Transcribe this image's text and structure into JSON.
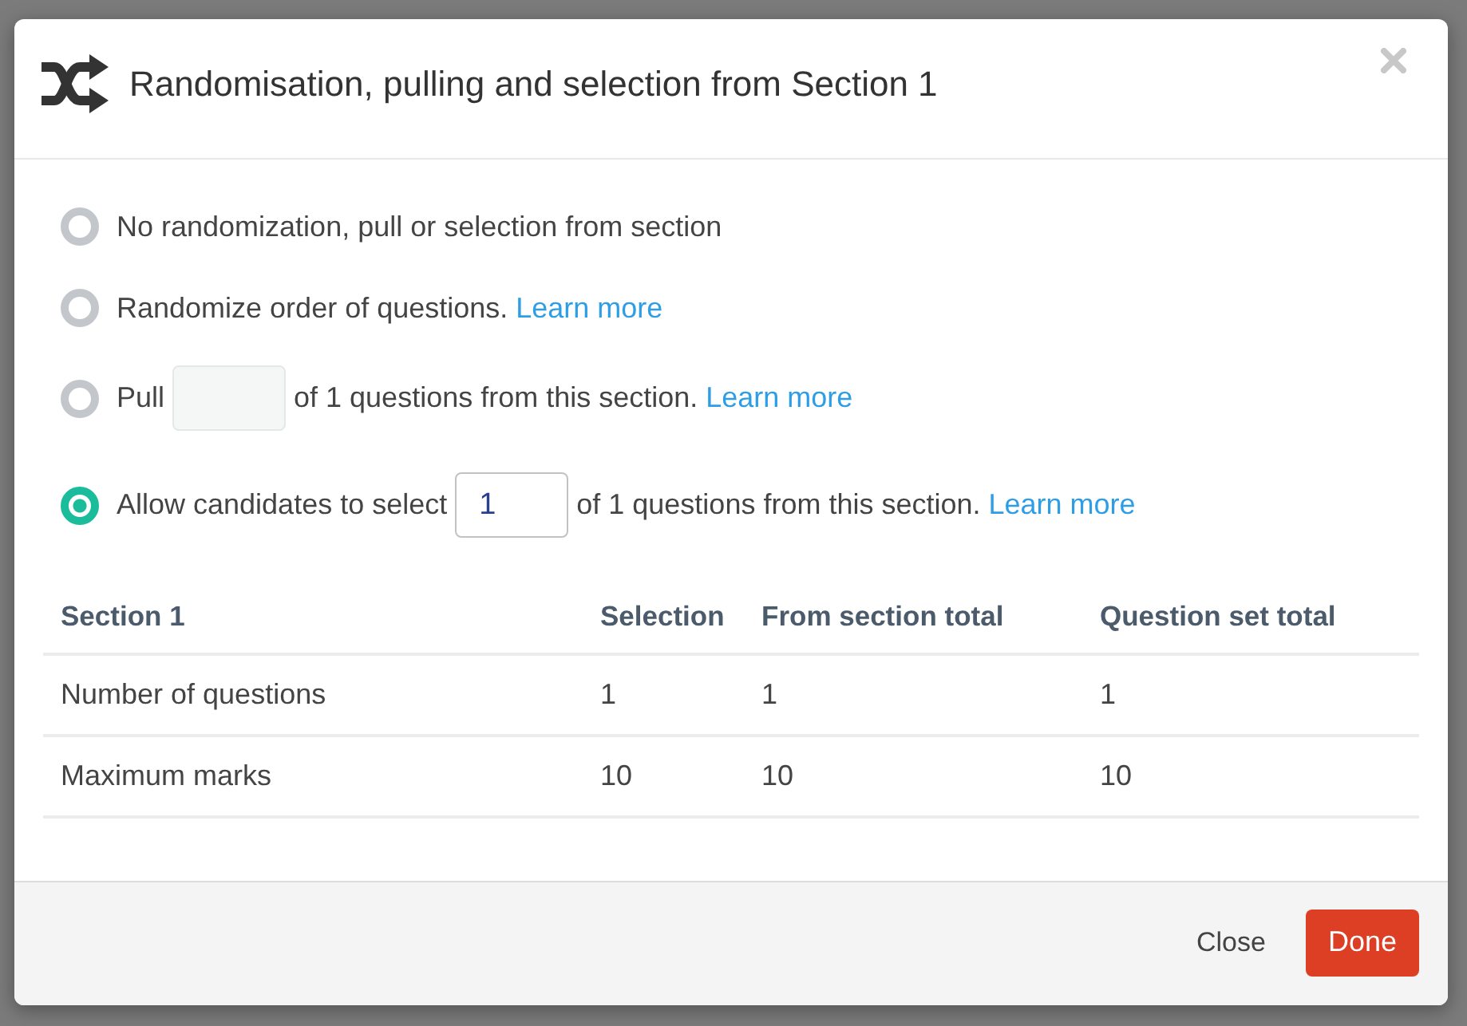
{
  "dialog": {
    "title": "Randomisation, pulling and selection from Section 1"
  },
  "options": [
    {
      "kind": "text",
      "label": "No randomization, pull or selection from section",
      "selected": false
    },
    {
      "kind": "text",
      "label": "Randomize order of questions.",
      "link": "Learn more",
      "selected": false
    },
    {
      "kind": "field",
      "label": "Pull",
      "field": {
        "disabled": true
      },
      "suffix": "of 1 questions from this section.",
      "link": "Learn more",
      "selected": false
    },
    {
      "kind": "field",
      "label": "Allow candidates to select",
      "field": {
        "value": "1",
        "disabled": false
      },
      "suffix": "of 1 questions from this section.",
      "link": "Learn more",
      "selected": true
    }
  ],
  "table": {
    "columns": [
      "Section 1",
      "Selection",
      "From section total",
      "Question set total"
    ],
    "rows": [
      [
        "Number of questions",
        "1",
        "1",
        "1"
      ],
      [
        "Maximum marks",
        "10",
        "10",
        "10"
      ]
    ]
  },
  "footer": {
    "buttons": [
      {
        "kind": "secondary",
        "label": "Close"
      },
      {
        "kind": "primary",
        "label": "Done"
      }
    ]
  }
}
